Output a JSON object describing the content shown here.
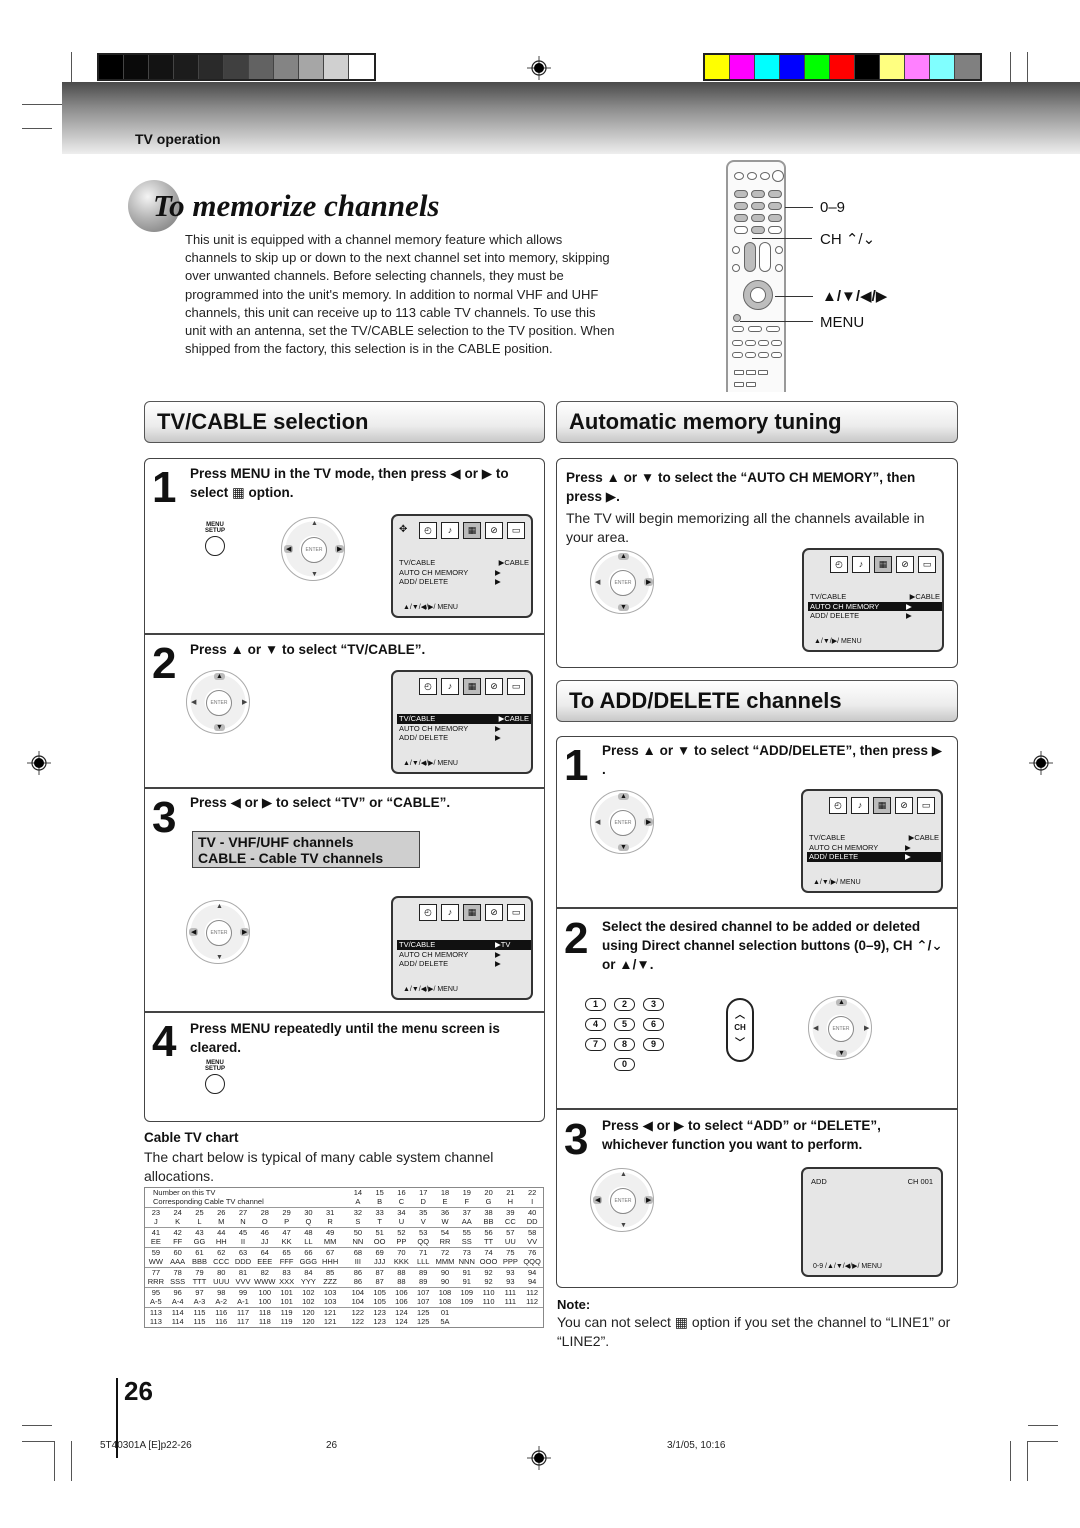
{
  "header": {
    "section_label": "TV operation",
    "gray_swatches": [
      "#000000",
      "#0a0a0a",
      "#131313",
      "#1c1c1c",
      "#2a2a2a",
      "#404040",
      "#626262",
      "#848484",
      "#a6a6a6",
      "#d0d0d0",
      "#ffffff"
    ],
    "color_swatches": [
      "#ffff00",
      "#ff00ff",
      "#00ffff",
      "#0000ff",
      "#00ff00",
      "#ff0000",
      "#000000",
      "#ffff80",
      "#ff80ff",
      "#80ffff",
      "#808080"
    ]
  },
  "title": "To memorize channels",
  "intro": "This unit is equipped with a channel memory feature which allows channels to skip up or down to the next channel set into memory, skipping over unwanted channels. Before selecting channels, they must be programmed into the unit's memory. In addition to normal VHF and UHF channels, this unit can receive up to 113 cable TV channels. To use this unit with an antenna, set the TV/CABLE selection to the TV position. When shipped from the factory, this selection is in the CABLE position.",
  "remote_callouts": {
    "digits": "0–9",
    "ch": "CH ⌃/⌄",
    "arrows": "▲/▼/◀/▶",
    "menu": "MENU"
  },
  "tvcable": {
    "heading": "TV/CABLE selection",
    "steps": [
      {
        "num": "1",
        "text": "Press MENU in the TV mode, then press ◀ or ▶ to select ▦ option."
      },
      {
        "num": "2",
        "text": "Press ▲ or ▼ to select “TV/CABLE”."
      },
      {
        "num": "3",
        "text": "Press ◀ or ▶ to select “TV” or “CABLE”."
      },
      {
        "num": "4",
        "text": "Press MENU repeatedly until the menu screen is cleared."
      }
    ],
    "info_box": [
      "TV - VHF/UHF channels",
      "CABLE - Cable TV channels"
    ],
    "menu_button_label": [
      "MENU",
      "SETUP"
    ],
    "enter_label": "ENTER"
  },
  "osd": {
    "rows": [
      "TV/CABLE",
      "AUTO  CH  MEMORY",
      "ADD/ DELETE"
    ],
    "value_cable": "▶CABLE",
    "value_tv": "▶TV",
    "value_arrow": "▶",
    "footer_4way": "▲/▼/◀/▶/ MENU",
    "footer_3way": "▲/▼/▶/ MENU",
    "add_screen": {
      "left": "ADD",
      "right": "CH 001",
      "footer": "0-9 /▲/▼/◀/▶/ MENU"
    }
  },
  "cable_chart": {
    "heading": "Cable TV chart",
    "description": "The chart below is typical of many cable system channel allocations.",
    "header_labels": [
      "Number on this TV",
      "Corresponding Cable TV channel"
    ],
    "header_row": {
      "numbers": [
        "14",
        "15",
        "16",
        "17",
        "18",
        "19",
        "20",
        "21",
        "22"
      ],
      "channels": [
        "A",
        "B",
        "C",
        "D",
        "E",
        "F",
        "G",
        "H",
        "I"
      ]
    },
    "rows": [
      {
        "numbers": [
          "23",
          "24",
          "25",
          "26",
          "27",
          "28",
          "29",
          "30",
          "31",
          "32",
          "33",
          "34",
          "35",
          "36",
          "37",
          "38",
          "39",
          "40"
        ],
        "channels": [
          "J",
          "K",
          "L",
          "M",
          "N",
          "O",
          "P",
          "Q",
          "R",
          "S",
          "T",
          "U",
          "V",
          "W",
          "AA",
          "BB",
          "CC",
          "DD"
        ]
      },
      {
        "numbers": [
          "41",
          "42",
          "43",
          "44",
          "45",
          "46",
          "47",
          "48",
          "49",
          "50",
          "51",
          "52",
          "53",
          "54",
          "55",
          "56",
          "57",
          "58"
        ],
        "channels": [
          "EE",
          "FF",
          "GG",
          "HH",
          "II",
          "JJ",
          "KK",
          "LL",
          "MM",
          "NN",
          "OO",
          "PP",
          "QQ",
          "RR",
          "SS",
          "TT",
          "UU",
          "VV"
        ]
      },
      {
        "numbers": [
          "59",
          "60",
          "61",
          "62",
          "63",
          "64",
          "65",
          "66",
          "67",
          "68",
          "69",
          "70",
          "71",
          "72",
          "73",
          "74",
          "75",
          "76"
        ],
        "channels": [
          "WW",
          "AAA",
          "BBB",
          "CCC",
          "DDD",
          "EEE",
          "FFF",
          "GGG",
          "HHH",
          "III",
          "JJJ",
          "KKK",
          "LLL",
          "MMM",
          "NNN",
          "OOO",
          "PPP",
          "QQQ"
        ]
      },
      {
        "numbers": [
          "77",
          "78",
          "79",
          "80",
          "81",
          "82",
          "83",
          "84",
          "85",
          "86",
          "87",
          "88",
          "89",
          "90",
          "91",
          "92",
          "93",
          "94"
        ],
        "channels": [
          "RRR",
          "SSS",
          "TTT",
          "UUU",
          "VVV",
          "WWW",
          "XXX",
          "YYY",
          "ZZZ",
          "86",
          "87",
          "88",
          "89",
          "90",
          "91",
          "92",
          "93",
          "94"
        ]
      },
      {
        "numbers": [
          "95",
          "96",
          "97",
          "98",
          "99",
          "100",
          "101",
          "102",
          "103",
          "104",
          "105",
          "106",
          "107",
          "108",
          "109",
          "110",
          "111",
          "112"
        ],
        "channels": [
          "A-5",
          "A-4",
          "A-3",
          "A-2",
          "A-1",
          "100",
          "101",
          "102",
          "103",
          "104",
          "105",
          "106",
          "107",
          "108",
          "109",
          "110",
          "111",
          "112"
        ]
      },
      {
        "numbers": [
          "113",
          "114",
          "115",
          "116",
          "117",
          "118",
          "119",
          "120",
          "121",
          "122",
          "123",
          "124",
          "125",
          "01",
          "",
          "",
          "",
          ""
        ],
        "channels": [
          "113",
          "114",
          "115",
          "116",
          "117",
          "118",
          "119",
          "120",
          "121",
          "122",
          "123",
          "124",
          "125",
          "5A",
          "",
          "",
          "",
          ""
        ]
      }
    ]
  },
  "auto": {
    "heading": "Automatic memory tuning",
    "instruction": "Press ▲ or ▼ to select the “AUTO CH MEMORY”, then press ▶.",
    "description": "The TV will begin memorizing all the channels available in your area."
  },
  "adddelete": {
    "heading": "To ADD/DELETE channels",
    "steps": [
      {
        "num": "1",
        "text": "Press ▲ or ▼ to select “ADD/DELETE”, then press ▶ ."
      },
      {
        "num": "2",
        "text": "Select the desired channel to be added or deleted using Direct channel selection buttons (0–9), CH ⌃/⌄ or ▲/▼."
      },
      {
        "num": "3",
        "text": "Press ◀ or ▶ to select “ADD” or “DELETE”, whichever function you want to perform."
      }
    ],
    "number_keys": [
      "1",
      "2",
      "3",
      "4",
      "5",
      "6",
      "7",
      "8",
      "9",
      "0"
    ],
    "ch_key_label": "CH"
  },
  "note": {
    "label": "Note:",
    "text": "You can not select ▦ option if you set the channel to “LINE1” or “LINE2”."
  },
  "page_number": "26",
  "footer": {
    "file": "5T40301A [E]p22-26",
    "page": "26",
    "date": "3/1/05, 10:16"
  }
}
